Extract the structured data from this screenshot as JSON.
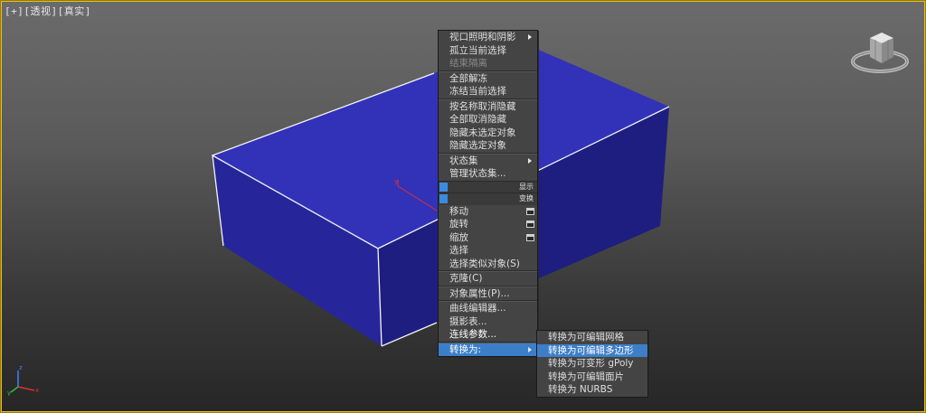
{
  "viewport": {
    "label_plus": "[+]",
    "label_view": "[透视]",
    "label_shading": "[真实]"
  },
  "colors": {
    "box_top": "#3030b8",
    "box_front": "#232390",
    "box_side": "#1c1c7a",
    "menu_bg": "#444444",
    "highlight": "#3c7fc8"
  },
  "main_menu": {
    "items": [
      {
        "label": "视口照明和阴影",
        "submenu": true
      },
      {
        "label": "孤立当前选择"
      },
      {
        "label": "结束隔离",
        "dim": true
      },
      {
        "sep": true
      },
      {
        "label": "全部解冻"
      },
      {
        "label": "冻结当前选择"
      },
      {
        "sep": true
      },
      {
        "label": "按名称取消隐藏"
      },
      {
        "label": "全部取消隐藏"
      },
      {
        "label": "隐藏未选定对象"
      },
      {
        "label": "隐藏选定对象"
      },
      {
        "sep": true
      },
      {
        "label": "状态集",
        "submenu": true
      },
      {
        "label": "管理状态集..."
      },
      {
        "quad": true,
        "label": "显示"
      },
      {
        "quad": true,
        "label": "变换"
      },
      {
        "label": "移动",
        "box": true
      },
      {
        "label": "旋转",
        "box": true
      },
      {
        "label": "缩放",
        "box": true
      },
      {
        "label": "选择"
      },
      {
        "label": "选择类似对象(S)"
      },
      {
        "sep": true
      },
      {
        "label": "克隆(C)"
      },
      {
        "sep": true
      },
      {
        "label": "对象属性(P)..."
      },
      {
        "sep": true
      },
      {
        "label": "曲线编辑器..."
      },
      {
        "label": "摄影表..."
      },
      {
        "label": "连线参数...",
        "bright": true
      },
      {
        "sep": true
      },
      {
        "label": "转换为:",
        "submenu": true,
        "highlight": true
      }
    ]
  },
  "convert_submenu": {
    "items": [
      {
        "label": "转换为可编辑网格"
      },
      {
        "label": "转换为可编辑多边形",
        "highlight": true
      },
      {
        "label": "转换为可变形 gPoly"
      },
      {
        "label": "转换为可编辑面片"
      },
      {
        "label": "转换为 NURBS"
      }
    ]
  },
  "axis_tripod": {
    "x": "x",
    "y": "y",
    "z": "z"
  }
}
